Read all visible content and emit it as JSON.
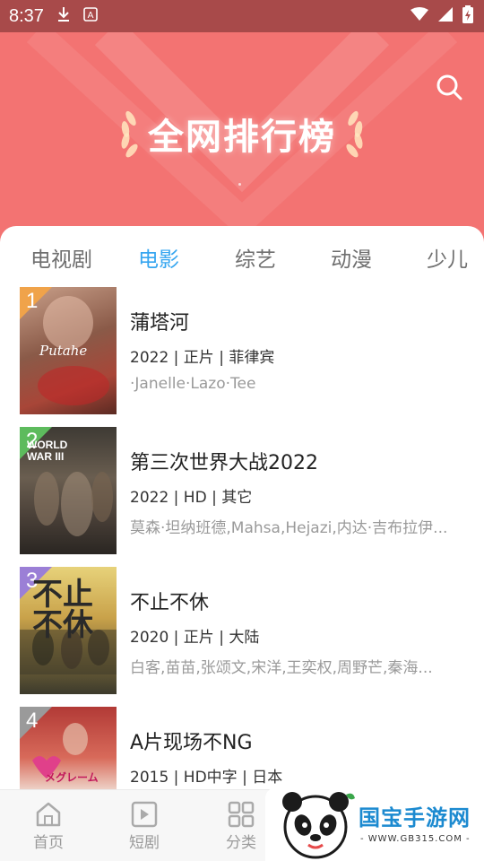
{
  "status_bar": {
    "time": "8:37",
    "download_icon": "download-icon",
    "notification_icon": "app-notification-icon",
    "wifi_icon": "wifi-icon",
    "signal_icon": "signal-icon",
    "battery_icon": "battery-icon"
  },
  "header": {
    "title": "全网排行榜",
    "search_icon": "search-icon",
    "background_color": "#f37372"
  },
  "tabs": [
    {
      "label": "电视剧",
      "active": false
    },
    {
      "label": "电影",
      "active": true
    },
    {
      "label": "综艺",
      "active": false
    },
    {
      "label": "动漫",
      "active": false
    },
    {
      "label": "少儿",
      "active": false
    }
  ],
  "active_tab_color": "#36a6f0",
  "items": [
    {
      "rank": "1",
      "title": "蒲塔河",
      "meta": "2022 | 正片 | 菲律宾",
      "cast": "·Janelle·Lazo·Tee",
      "rank_color": "#f0a34a",
      "poster_text": "Putahe"
    },
    {
      "rank": "2",
      "title": "第三次世界大战2022",
      "meta": "2022 | HD | 其它",
      "cast": "莫森·坦纳班德,Mahsa,Hejazi,内达·吉布拉伊...",
      "rank_color": "#5dbb5d",
      "poster_text": "WORLD WAR III"
    },
    {
      "rank": "3",
      "title": "不止不休",
      "meta": "2020 | 正片 | 大陆",
      "cast": "白客,苗苗,张颂文,宋洋,王奕权,周野芒,秦海...",
      "rank_color": "#9b7fd6",
      "poster_text": "不止不休"
    },
    {
      "rank": "4",
      "title": "A片现场不NG",
      "meta": "2015 | HD中字 | 日本",
      "cast": "",
      "rank_color": "#9a9a9a",
      "poster_text": "メグレーム"
    }
  ],
  "bottom_nav": [
    {
      "label": "首页",
      "icon": "home-icon"
    },
    {
      "label": "短剧",
      "icon": "play-icon"
    },
    {
      "label": "分类",
      "icon": "grid-icon"
    }
  ],
  "watermark": {
    "text": "国宝手游网",
    "url": "- WWW.GB315.COM -",
    "icon": "panda-logo-icon"
  }
}
